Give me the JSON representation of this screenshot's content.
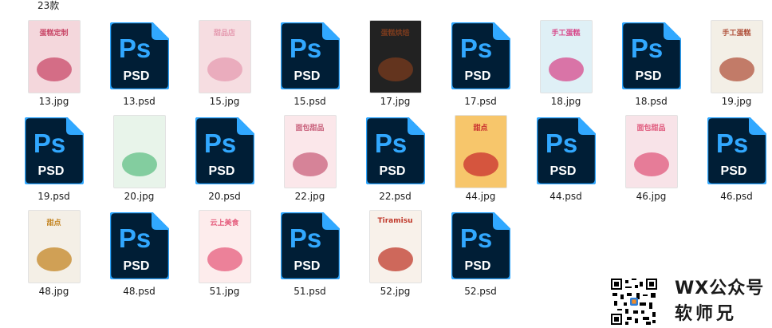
{
  "folder": {
    "item_count_label": "23款"
  },
  "ps_icon": {
    "logo_text": "Ps",
    "type_text": "PSD"
  },
  "files": [
    {
      "name": "13.jpg",
      "kind": "jpg",
      "poster_text": "蛋糕定制",
      "bg": "#f4d7dc",
      "accent": "#c94a6a"
    },
    {
      "name": "13.psd",
      "kind": "psd"
    },
    {
      "name": "15.jpg",
      "kind": "jpg",
      "poster_text": "甜品店",
      "bg": "#f6dde1",
      "accent": "#e59bb0"
    },
    {
      "name": "15.psd",
      "kind": "psd"
    },
    {
      "name": "17.jpg",
      "kind": "jpg",
      "poster_text": "蛋糕烘焙",
      "bg": "#222222",
      "accent": "#7a3b1e"
    },
    {
      "name": "17.psd",
      "kind": "psd"
    },
    {
      "name": "18.jpg",
      "kind": "jpg",
      "poster_text": "手工蛋糕",
      "bg": "#dff0f6",
      "accent": "#d74b8c"
    },
    {
      "name": "18.psd",
      "kind": "psd"
    },
    {
      "name": "19.jpg",
      "kind": "jpg",
      "poster_text": "手工蛋糕",
      "bg": "#f3efe6",
      "accent": "#b1543e"
    },
    {
      "name": "19.psd",
      "kind": "psd"
    },
    {
      "name": "20.jpg",
      "kind": "jpg",
      "poster_text": "",
      "bg": "#e8f4ea",
      "accent": "#62c086"
    },
    {
      "name": "20.psd",
      "kind": "psd"
    },
    {
      "name": "22.jpg",
      "kind": "jpg",
      "poster_text": "面包甜品",
      "bg": "#fbe7ea",
      "accent": "#c9617c"
    },
    {
      "name": "22.psd",
      "kind": "psd"
    },
    {
      "name": "44.jpg",
      "kind": "jpg",
      "poster_text": "甜点",
      "bg": "#f7c66b",
      "accent": "#c92f2f"
    },
    {
      "name": "44.psd",
      "kind": "psd"
    },
    {
      "name": "46.jpg",
      "kind": "jpg",
      "poster_text": "面包甜品",
      "bg": "#f8e3e8",
      "accent": "#e05a7d"
    },
    {
      "name": "46.psd",
      "kind": "psd"
    },
    {
      "name": "48.jpg",
      "kind": "jpg",
      "poster_text": "甜点",
      "bg": "#f4efe6",
      "accent": "#c48624"
    },
    {
      "name": "48.psd",
      "kind": "psd"
    },
    {
      "name": "51.jpg",
      "kind": "jpg",
      "poster_text": "云上美食",
      "bg": "#fdecec",
      "accent": "#e55d7d"
    },
    {
      "name": "51.psd",
      "kind": "psd"
    },
    {
      "name": "52.jpg",
      "kind": "jpg",
      "poster_text": "Tiramisu",
      "bg": "#f8f1ea",
      "accent": "#c0392b"
    },
    {
      "name": "52.psd",
      "kind": "psd"
    }
  ],
  "watermark": {
    "line1": "WX公众号",
    "line2": "软师兄"
  },
  "colors": {
    "ps_dark": "#001e36",
    "ps_blue": "#31a8ff",
    "ps_fold": "#31a8ff"
  }
}
